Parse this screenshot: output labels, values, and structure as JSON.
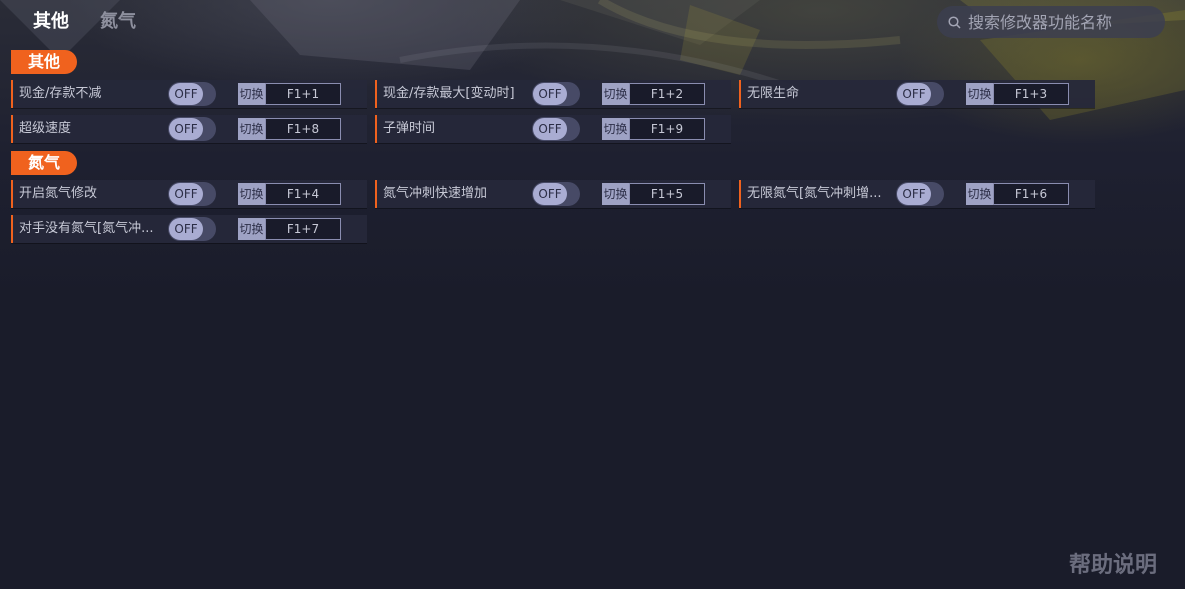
{
  "nav": {
    "tabs": [
      {
        "label": "其他",
        "active": true
      },
      {
        "label": "氮气",
        "active": false
      }
    ]
  },
  "search": {
    "placeholder": "搜索修改器功能名称",
    "icon": "search-icon"
  },
  "sections": [
    {
      "title": "其他",
      "items": [
        {
          "label": "现金/存款不减",
          "state": "OFF",
          "switch_label": "切换",
          "hotkey": "F1+1"
        },
        {
          "label": "现金/存款最大[变动时]",
          "state": "OFF",
          "switch_label": "切换",
          "hotkey": "F1+2"
        },
        {
          "label": "无限生命",
          "state": "OFF",
          "switch_label": "切换",
          "hotkey": "F1+3"
        },
        {
          "label": "超级速度",
          "state": "OFF",
          "switch_label": "切换",
          "hotkey": "F1+8"
        },
        {
          "label": "子弹时间",
          "state": "OFF",
          "switch_label": "切换",
          "hotkey": "F1+9"
        }
      ]
    },
    {
      "title": "氮气",
      "items": [
        {
          "label": "开启氮气修改",
          "state": "OFF",
          "switch_label": "切换",
          "hotkey": "F1+4"
        },
        {
          "label": "氮气冲刺快速增加",
          "state": "OFF",
          "switch_label": "切换",
          "hotkey": "F1+5"
        },
        {
          "label": "无限氮气[氮气冲刺增...",
          "state": "OFF",
          "switch_label": "切换",
          "hotkey": "F1+6"
        },
        {
          "label": "对手没有氮气[氮气冲...",
          "state": "OFF",
          "switch_label": "切换",
          "hotkey": "F1+7"
        }
      ]
    }
  ],
  "footer": {
    "help_label": "帮助说明"
  },
  "colors": {
    "accent": "#f0621e",
    "background": "#1b1d2c",
    "row_bg": "#26283a",
    "toggle_knob": "#a9acd2"
  }
}
